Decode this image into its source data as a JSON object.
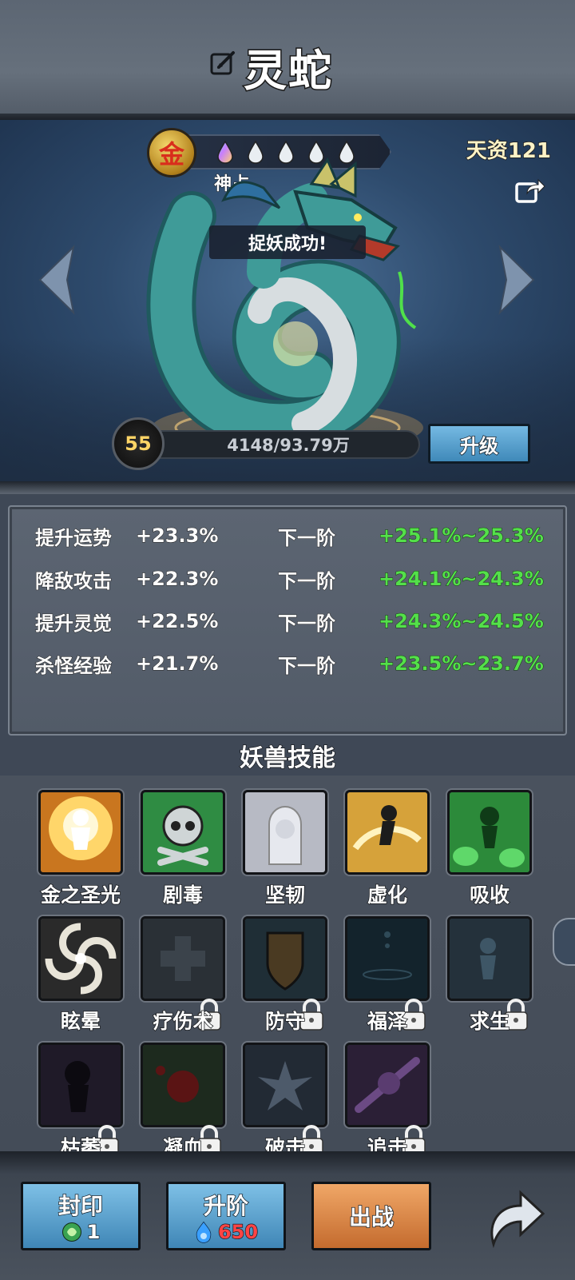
{
  "header": {
    "beast_name": "灵蛇",
    "rename_icon": "edit-icon"
  },
  "display": {
    "rank_badge": "金",
    "grade_text": "神占",
    "aptitude": "天资121",
    "toast": "捉妖成功!",
    "level": "55",
    "exp_text": "4148/93.79万",
    "exp_progress": 0.0044,
    "upgrade_label": "升级",
    "star_count": 5,
    "share_icon": "share-icon"
  },
  "stats": [
    {
      "name": "提升运势",
      "value": "+23.3%",
      "next_label": "下一阶",
      "range": "+25.1%~25.3%"
    },
    {
      "name": "降敌攻击",
      "value": "+22.3%",
      "next_label": "下一阶",
      "range": "+24.1%~24.3%"
    },
    {
      "name": "提升灵觉",
      "value": "+22.5%",
      "next_label": "下一阶",
      "range": "+24.3%~24.5%"
    },
    {
      "name": "杀怪经验",
      "value": "+21.7%",
      "next_label": "下一阶",
      "range": "+23.5%~23.7%"
    }
  ],
  "skills_title": "妖兽技能",
  "skills": [
    {
      "label": "金之圣光",
      "locked": false
    },
    {
      "label": "剧毒",
      "locked": false
    },
    {
      "label": "坚韧",
      "locked": false
    },
    {
      "label": "虚化",
      "locked": false
    },
    {
      "label": "吸收",
      "locked": false
    },
    {
      "label": "眩晕",
      "locked": false
    },
    {
      "label": "疗伤术",
      "locked": true
    },
    {
      "label": "防守",
      "locked": true
    },
    {
      "label": "福泽",
      "locked": true
    },
    {
      "label": "求生",
      "locked": true
    },
    {
      "label": "枯萎",
      "locked": true
    },
    {
      "label": "凝血",
      "locked": true
    },
    {
      "label": "破击",
      "locked": true
    },
    {
      "label": "追击",
      "locked": true
    }
  ],
  "bottom": {
    "seal_label": "封印",
    "seal_count": "1",
    "advance_label": "升阶",
    "advance_cost": "650",
    "battle_label": "出战"
  },
  "colors": {
    "stat_green": "#54e04a",
    "button_blue": "#5aa3d0",
    "button_orange": "#d98a4a",
    "gold": "#d9a52c"
  }
}
